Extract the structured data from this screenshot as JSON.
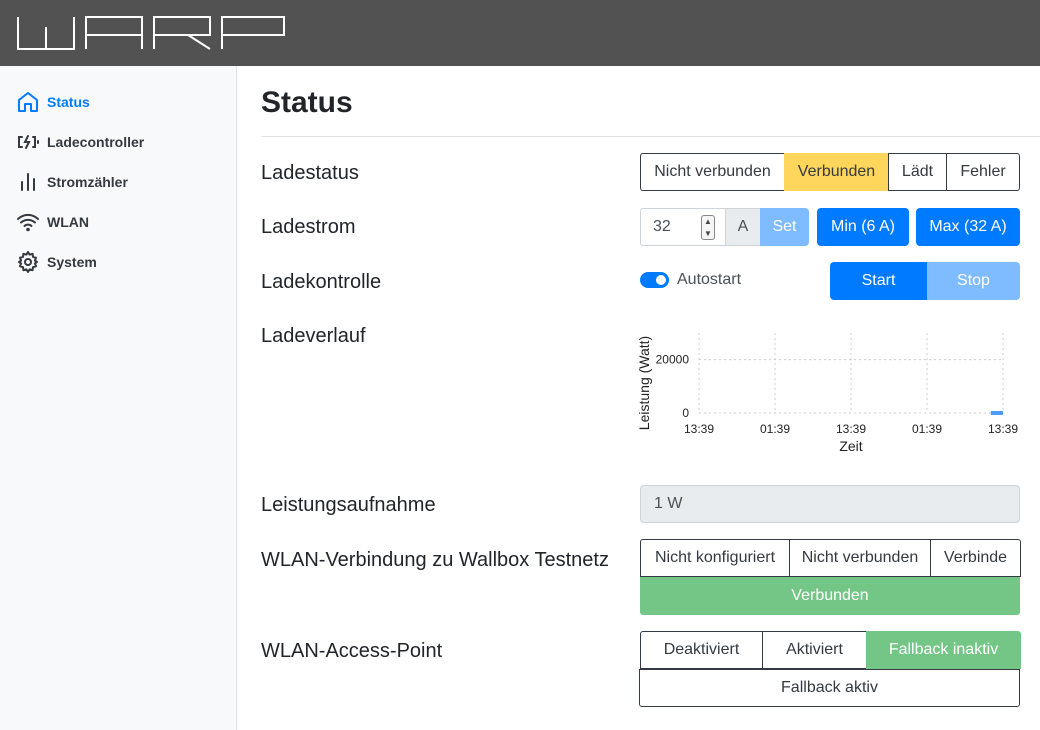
{
  "header": {
    "logo_text": "WARP"
  },
  "sidebar": {
    "items": [
      {
        "label": "Status",
        "icon": "home-icon",
        "active": true
      },
      {
        "label": "Ladecontroller",
        "icon": "charger-icon"
      },
      {
        "label": "Stromzähler",
        "icon": "bar-chart-icon"
      },
      {
        "label": "WLAN",
        "icon": "wifi-icon"
      },
      {
        "label": "System",
        "icon": "gear-icon"
      }
    ]
  },
  "page": {
    "title": "Status",
    "ladestatus": {
      "label": "Ladestatus",
      "options": [
        "Nicht verbunden",
        "Verbunden",
        "Lädt",
        "Fehler"
      ],
      "active": "Verbunden",
      "active_color": "#ffd65c"
    },
    "ladestrom": {
      "label": "Ladestrom",
      "value": "32",
      "unit": "A",
      "set_label": "Set",
      "min_label": "Min (6 A)",
      "max_label": "Max (32 A)"
    },
    "ladekontrolle": {
      "label": "Ladekontrolle",
      "autostart_label": "Autostart",
      "autostart_on": true,
      "start_label": "Start",
      "stop_label": "Stop"
    },
    "ladeverlauf": {
      "label": "Ladeverlauf"
    },
    "leistungsaufnahme": {
      "label": "Leistungsaufnahme",
      "value": "1 W"
    },
    "wlan_verbindung": {
      "label": "WLAN-Verbindung zu Wallbox Testnetz",
      "options": [
        "Nicht konfiguriert",
        "Nicht verbunden",
        "Verbinde"
      ],
      "status": "Verbunden",
      "status_color": "#74c687"
    },
    "wlan_ap": {
      "label": "WLAN-Access-Point",
      "options": [
        "Deaktiviert",
        "Aktiviert",
        "Fallback inaktiv"
      ],
      "active": "Fallback inaktiv",
      "secondary": "Fallback aktiv"
    }
  },
  "chart_data": {
    "type": "line",
    "xlabel": "Zeit",
    "ylabel": "Leistung (Watt)",
    "x_ticks": [
      "13:39",
      "01:39",
      "13:39",
      "01:39",
      "13:39"
    ],
    "y_ticks": [
      0,
      20000
    ],
    "ylim": [
      0,
      30000
    ],
    "grid": true,
    "series": [
      {
        "x": [
          0.96,
          1.0
        ],
        "values": [
          1,
          1
        ],
        "color": "#4c9cff"
      }
    ]
  }
}
